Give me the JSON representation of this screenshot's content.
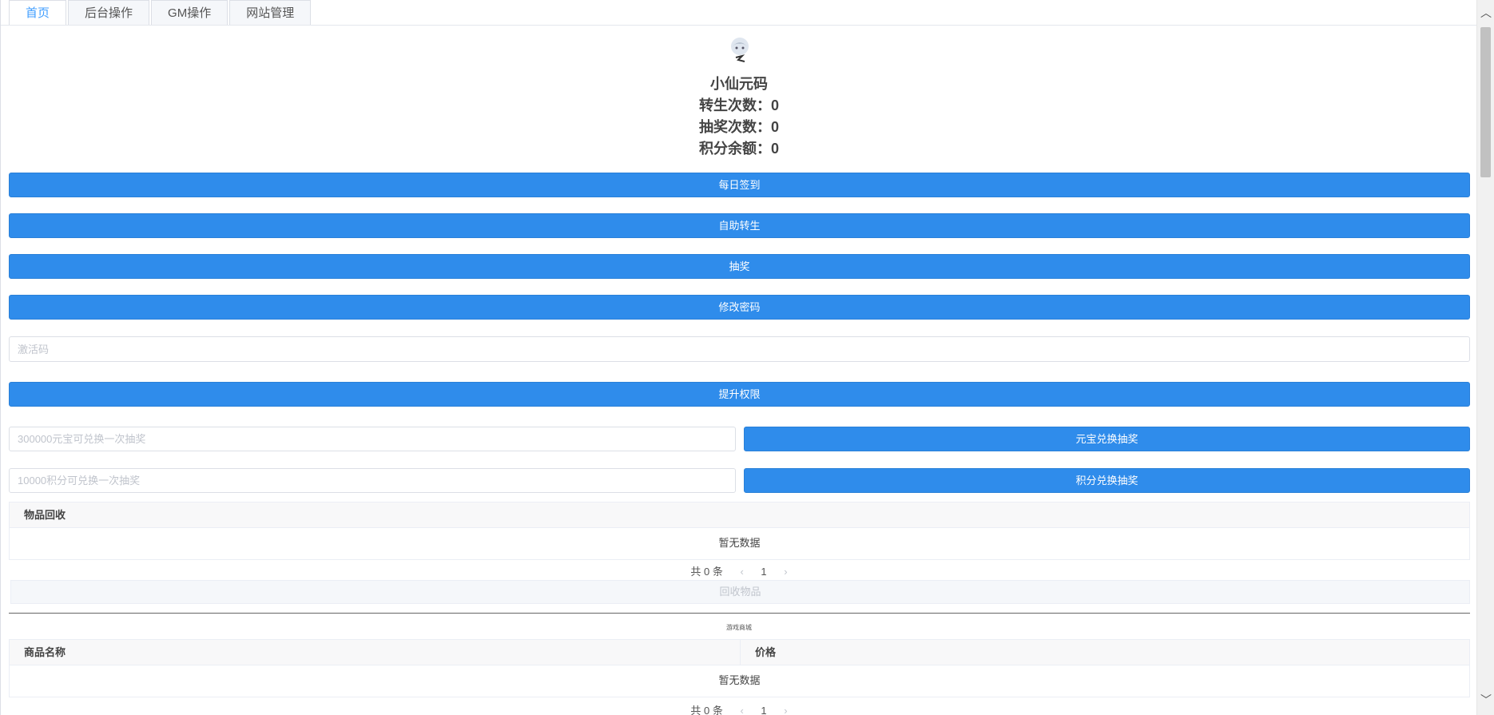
{
  "tabs": [
    {
      "label": "首页",
      "active": true
    },
    {
      "label": "后台操作",
      "active": false
    },
    {
      "label": "GM操作",
      "active": false
    },
    {
      "label": "网站管理",
      "active": false
    }
  ],
  "profile": {
    "name": "小仙元码",
    "rebirth": "转生次数：0",
    "lottery": "抽奖次数：0",
    "points": "积分余额：0"
  },
  "buttons": {
    "daily_signin": "每日签到",
    "auto_rebirth": "自助转生",
    "lottery": "抽奖",
    "change_password": "修改密码",
    "upgrade": "提升权限",
    "ingot_exchange": "元宝兑换抽奖",
    "points_exchange": "积分兑换抽奖",
    "recycle": "回收物品"
  },
  "inputs": {
    "activation_placeholder": "激活码",
    "ingot_placeholder": "300000元宝可兑换一次抽奖",
    "points_placeholder": "10000积分可兑换一次抽奖"
  },
  "recycle_table": {
    "header": "物品回收",
    "empty_text": "暂无数据"
  },
  "recycle_pager": {
    "total": "共 0 条",
    "page": "1"
  },
  "shop": {
    "title": "游戏商城",
    "col_name": "商品名称",
    "col_price": "价格",
    "empty_text": "暂无数据"
  },
  "shop_pager": {
    "total": "共 0 条",
    "page": "1"
  },
  "colors": {
    "primary": "#2f8ceb",
    "tab_active": "#409eff"
  }
}
